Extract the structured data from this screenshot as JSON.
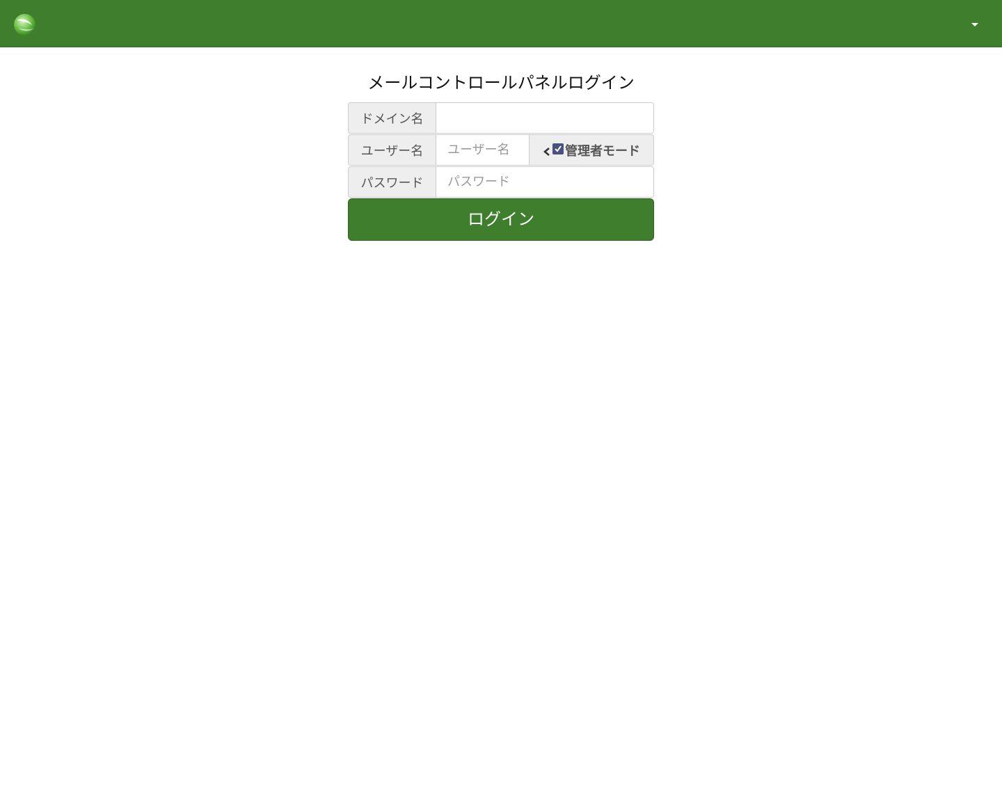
{
  "header": {
    "logo_icon": "globe-leaf-logo-icon",
    "menu_icon": "caret-down-icon",
    "color": "#3e7e2c"
  },
  "login": {
    "title": "メールコントロールパネルログイン",
    "domain_label": "ドメイン名",
    "domain_value": "",
    "domain_placeholder": "",
    "username_label": "ユーザー名",
    "username_placeholder": "ユーザー名",
    "admin_mode_label": "管理者モード",
    "admin_mode_checked": true,
    "password_label": "パスワード",
    "password_placeholder": "パスワード",
    "submit_label": "ログイン"
  }
}
